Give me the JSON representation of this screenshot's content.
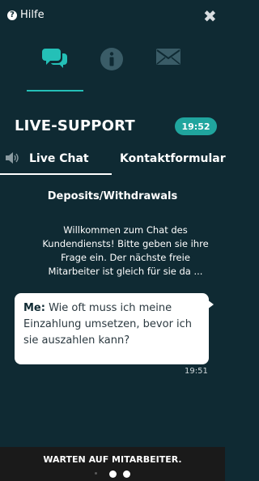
{
  "header": {
    "help_label": "Hilfe",
    "help_icon": "question-circle-icon",
    "close_icon": "close-icon"
  },
  "icon_tabs": [
    {
      "name": "chat-bubbles-icon",
      "active": true,
      "color": "#24c0b7"
    },
    {
      "name": "info-icon",
      "active": false,
      "color": "#3a5c67"
    },
    {
      "name": "envelope-icon",
      "active": false,
      "color": "#3a5c67"
    }
  ],
  "title": "LIVE-SUPPORT",
  "status_time": "19:52",
  "chat_tabs": {
    "live_chat": "Live Chat",
    "kontaktformular": "Kontaktformular",
    "speaker_icon": "speaker-icon"
  },
  "topic": "Deposits/Withdrawals",
  "welcome": "Willkommen zum Chat des Kundendiensts! Bitte geben sie ihre Frage ein. Der nächste freie Mitarbeiter ist gleich für sie da ...",
  "message": {
    "sender": "Me:",
    "text": "Wie oft muss ich meine Einzahlung umsetzen, bevor ich sie auszahlen kann?",
    "time": "19:51"
  },
  "footer": {
    "status": "WARTEN AUF MITARBEITER."
  },
  "colors": {
    "background": "#0f2a33",
    "accent": "#24c0b7",
    "badge": "#20a59e",
    "footer": "#1a1a1a"
  }
}
